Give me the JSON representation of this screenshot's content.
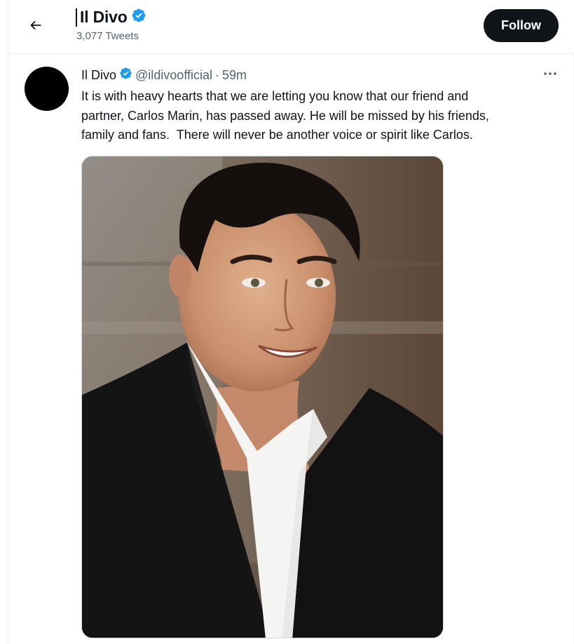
{
  "header": {
    "back_icon": "arrow-left-icon",
    "title": "Il Divo",
    "tweet_count": "3,077 Tweets",
    "follow_label": "Follow"
  },
  "tweet": {
    "author_name": "Il Divo",
    "handle": "@ildivoofficial",
    "separator": "·",
    "time": "59m",
    "text": "It is with heavy hearts that we are letting you know that our friend and\npartner, Carlos Marin, has passed away. He will be missed by his friends,\nfamily and fans.  There will never be another voice or spirit like Carlos.",
    "more_icon": "more-horizontal-icon",
    "media_description_icon": "photo"
  },
  "colors": {
    "verified": "#1d9bf0",
    "follow_bg": "#0f1419",
    "secondary_text": "#536471"
  }
}
